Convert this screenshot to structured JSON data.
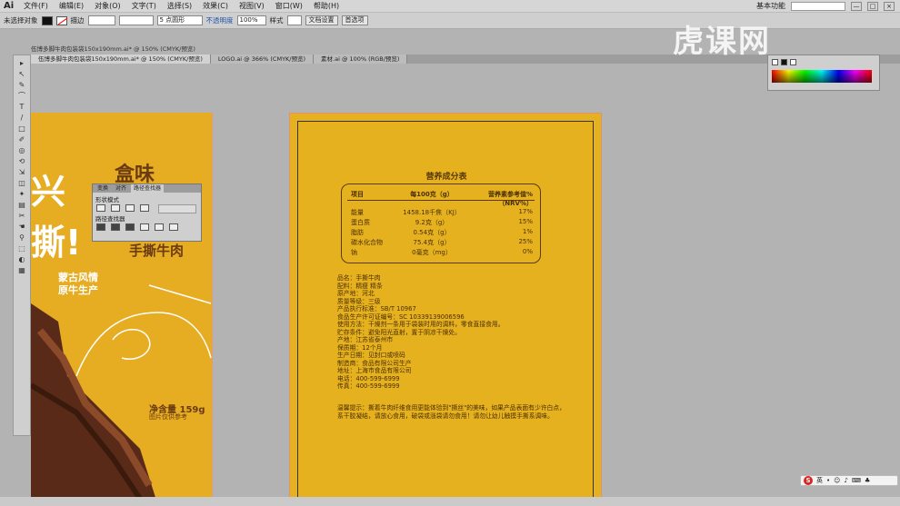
{
  "app": {
    "logo": "Ai",
    "menu": [
      "文件(F)",
      "编辑(E)",
      "对象(O)",
      "文字(T)",
      "选择(S)",
      "效果(C)",
      "视图(V)",
      "窗口(W)",
      "帮助(H)"
    ],
    "workspace": "基本功能",
    "window_buttons": [
      "—",
      "□",
      "×"
    ]
  },
  "controlbar": {
    "selection": "未选择对象",
    "stroke_label": "描边",
    "stroke_size": "5 点圆形",
    "opacity_label": "不透明度",
    "opacity_value": "100%",
    "style_label": "样式",
    "doc_settings": "文档设置",
    "preferences": "首选项"
  },
  "tabs": {
    "closed_title": "伍博多脚牛肉包装袋150x190mm.ai* @ 150% (CMYK/预览)",
    "items": [
      "伍博多脚牛肉包装袋150x190mm.ai* @ 150% (CMYK/预览)",
      "LOGO.ai @ 366% (CMYK/预览)",
      "素材.ai @ 100% (RGB/预览)"
    ]
  },
  "tools": [
    "▸",
    "↖",
    "✎",
    "⌒",
    "T",
    "/",
    "□",
    "✐",
    "◎",
    "⟲",
    "⇲",
    "◫",
    "✦",
    "▤",
    "✂",
    "☚",
    "⚲",
    "⬚",
    "◐",
    "▦"
  ],
  "pathfinder_panel": {
    "tabs": [
      "变换",
      "对齐",
      "路径查找器"
    ],
    "shape_modes_label": "形状模式",
    "pathfinders_label": "路径查找器"
  },
  "front_package": {
    "big_chars": [
      "兴",
      "撕!"
    ],
    "product_name": "手撕牛肉",
    "brand": "盒味",
    "slogan": [
      "蒙古风情",
      "原牛生产"
    ],
    "net_weight": "净含量 159g",
    "image_note": "图片仅供参考"
  },
  "nutrition": {
    "title": "营养成分表",
    "headers": [
      "项目",
      "每100克（g）",
      "营养素参考值%（NRV%）"
    ],
    "rows": [
      [
        "能量",
        "1458.18千焦（KJ）",
        "17%"
      ],
      [
        "蛋白质",
        "9.2克（g）",
        "15%"
      ],
      [
        "脂肪",
        "0.54克（g）",
        "1%"
      ],
      [
        "碳水化合物",
        "75.4克（g）",
        "25%"
      ],
      [
        "钠",
        "0毫克（mg）",
        "0%"
      ]
    ]
  },
  "product_info": [
    "品名：手撕牛肉",
    "配料：精瘦 精条",
    "原产地：河北",
    "质量等级：三级",
    "产品执行标准：SB/T 10967",
    "食品生产许可证编号：SC 10339139006596",
    "使用方法：干燥剂一条用于袋装时用的调料，零食直接食用。",
    "贮存条件：避免阳光直射，置于阴凉干燥处。",
    "产地：江苏省泰州市",
    "保质期：12个月",
    "生产日期：见封口或喷码",
    "制造商：食品有限公司生产",
    "地址：上海市食品有限公司",
    "电话：400-599-6999",
    "传真：400-599-6999"
  ],
  "warning": [
    "温馨提示：撕着牛肉纤维食用更能体验到\"撕丝\"的美味，如果产品表面有少许白点，",
    "系干胶凝结，请放心食用，破袋或涨袋请勿食用！请勿让幼儿触摸手撕系调味。"
  ],
  "watermark": "虎课网",
  "tray": {
    "badge": "S",
    "lang": "英"
  }
}
